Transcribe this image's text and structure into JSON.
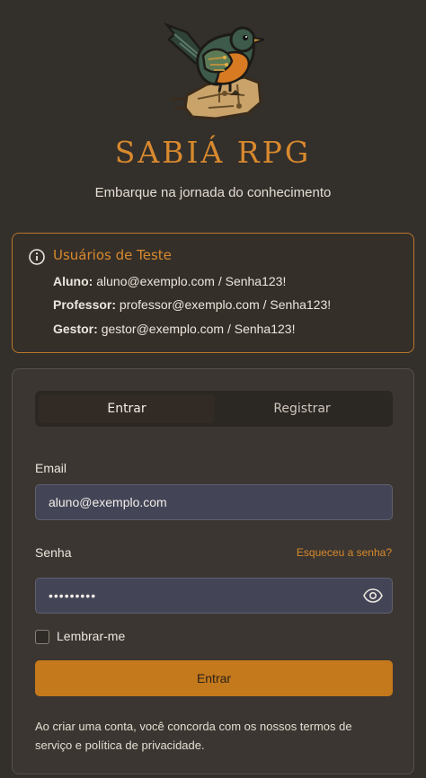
{
  "header": {
    "brand": "SABIÁ RPG",
    "tagline": "Embarque na jornada do conhecimento",
    "logo_icon": "sabia-bird-logo"
  },
  "test_users": {
    "icon": "info-icon",
    "title": "Usuários de Teste",
    "entries": [
      {
        "role": "Aluno:",
        "credentials": "aluno@exemplo.com / Senha123!"
      },
      {
        "role": "Professor:",
        "credentials": "professor@exemplo.com / Senha123!"
      },
      {
        "role": "Gestor:",
        "credentials": "gestor@exemplo.com / Senha123!"
      }
    ]
  },
  "auth": {
    "tabs": [
      {
        "label": "Entrar",
        "active": true
      },
      {
        "label": "Registrar",
        "active": false
      }
    ],
    "email_label": "Email",
    "email_value": "aluno@exemplo.com",
    "password_label": "Senha",
    "forgot_link": "Esqueceu a senha?",
    "password_value": "•••••••••",
    "remember_label": "Lembrar-me",
    "submit_label": "Entrar",
    "terms": "Ao criar uma conta, você concorda com os nossos termos de serviço e política de privacidade."
  },
  "colors": {
    "background": "#332f2b",
    "accent": "#c4791c",
    "brand_text": "#d8892e",
    "input_bg": "#434557"
  }
}
